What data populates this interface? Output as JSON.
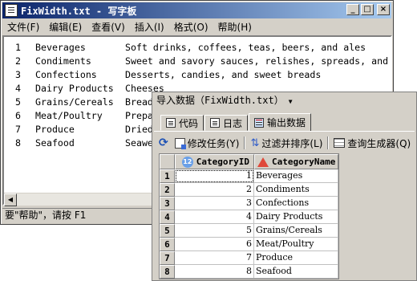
{
  "wordpad": {
    "title": "FixWidth.txt - 写字板",
    "menu": [
      "文件(F)",
      "编辑(E)",
      "查看(V)",
      "插入(I)",
      "格式(O)",
      "帮助(H)"
    ],
    "rows": [
      {
        "id": "1",
        "name": "Beverages",
        "desc": "Soft drinks, coffees, teas, beers, and ales"
      },
      {
        "id": "2",
        "name": "Condiments",
        "desc": "Sweet and savory sauces, relishes, spreads, and"
      },
      {
        "id": "3",
        "name": "Confections",
        "desc": "Desserts, candies, and sweet breads"
      },
      {
        "id": "4",
        "name": "Dairy Products",
        "desc": "Cheeses"
      },
      {
        "id": "5",
        "name": "Grains/Cereals",
        "desc": "Bread"
      },
      {
        "id": "6",
        "name": "Meat/Poultry",
        "desc": "Prepa"
      },
      {
        "id": "7",
        "name": "Produce",
        "desc": "Dried"
      },
      {
        "id": "8",
        "name": "Seafood",
        "desc": "Seawe"
      }
    ],
    "status": "要\"帮助\"，请按 F1"
  },
  "query": {
    "title": "导入数据（FixWidth.txt）",
    "tabs": [
      "代码",
      "日志",
      "输出数据"
    ],
    "active_tab": "输出数据",
    "toolbar": {
      "edit_task": "修改任务(Y)",
      "filter_sort": "过滤并排序(L)",
      "query_builder": "查询生成器(Q)"
    },
    "grid": {
      "columns": [
        "CategoryID",
        "CategoryName"
      ],
      "rows": [
        {
          "n": "1",
          "id": "1",
          "name": "Beverages"
        },
        {
          "n": "2",
          "id": "2",
          "name": "Condiments"
        },
        {
          "n": "3",
          "id": "3",
          "name": "Confections"
        },
        {
          "n": "4",
          "id": "4",
          "name": "Dairy Products"
        },
        {
          "n": "5",
          "id": "5",
          "name": "Grains/Cereals"
        },
        {
          "n": "6",
          "id": "6",
          "name": "Meat/Poultry"
        },
        {
          "n": "7",
          "id": "7",
          "name": "Produce"
        },
        {
          "n": "8",
          "id": "8",
          "name": "Seafood"
        }
      ]
    }
  }
}
